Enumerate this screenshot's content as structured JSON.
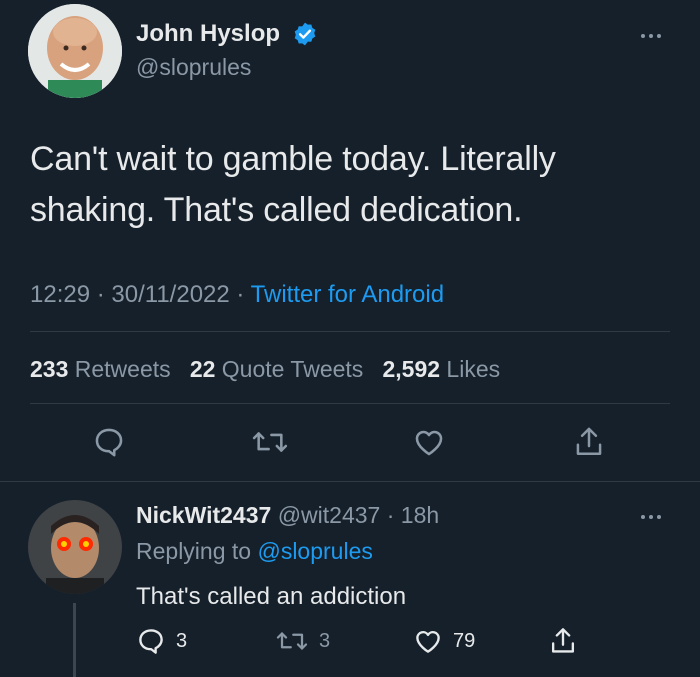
{
  "tweet": {
    "author_name": "John Hyslop",
    "handle": "@sloprules",
    "verified": true,
    "text_line1": "Can't wait to gamble today. Literally",
    "text_line2": "shaking. That's called dedication.",
    "time": "12:29",
    "date": "30/11/2022",
    "source": "Twitter for Android",
    "stats": {
      "retweets_count": "233",
      "retweets_label": "Retweets",
      "quotes_count": "22",
      "quotes_label": "Quote Tweets",
      "likes_count": "2,592",
      "likes_label": "Likes"
    }
  },
  "reply": {
    "author_name": "NickWit2437",
    "handle": "@wit2437",
    "age": "18h",
    "replying_prefix": "Replying to",
    "replying_to": "@sloprules",
    "text": "That's called an addiction",
    "reply_count": "3",
    "retweet_count": "3",
    "like_count": "79"
  },
  "colors": {
    "background": "#15202b",
    "accent": "#1d9bf0",
    "muted": "#8b98a5",
    "text": "#e7e9ea"
  },
  "icons": [
    "verified-badge-icon",
    "more-icon",
    "reply-icon",
    "retweet-icon",
    "like-icon",
    "share-icon"
  ]
}
